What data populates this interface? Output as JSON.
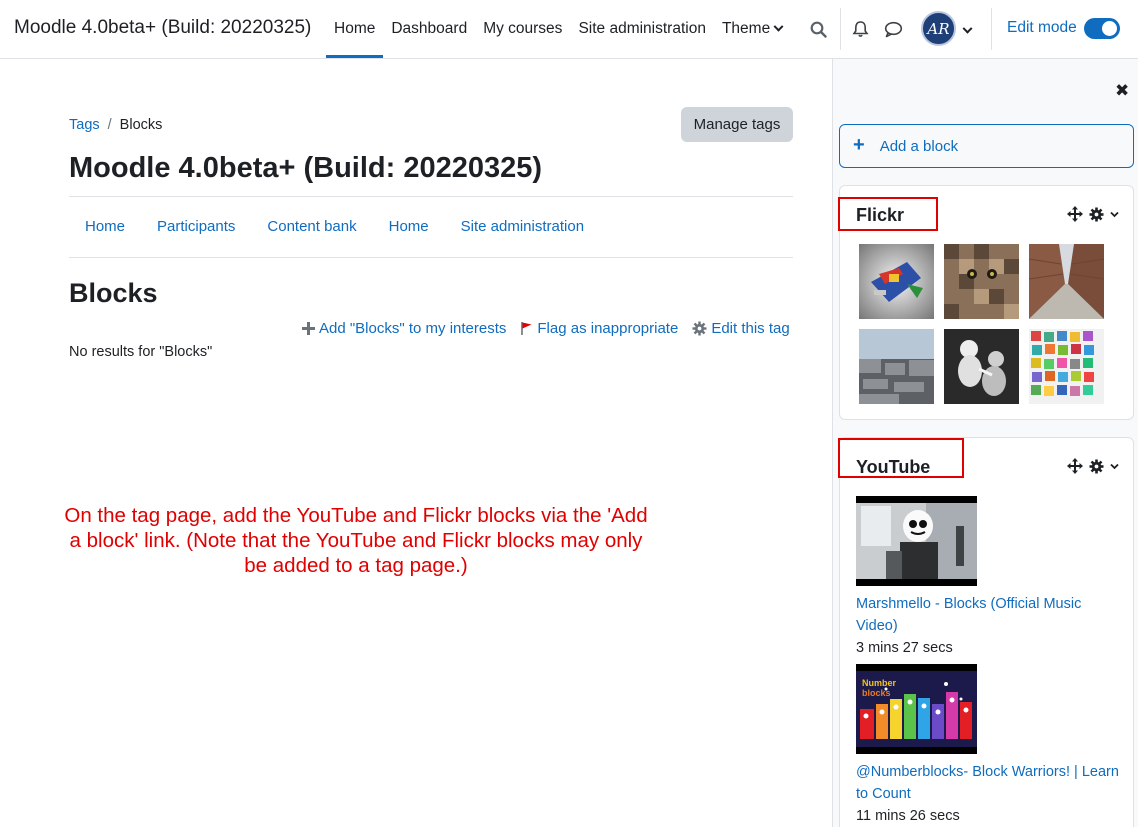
{
  "header": {
    "site_name": "Moodle 4.0beta+ (Build: 20220325)",
    "nav": [
      "Home",
      "Dashboard",
      "My courses",
      "Site administration",
      "Theme"
    ],
    "active_nav": "Home",
    "avatar_initials": "AR",
    "edit_mode_label": "Edit mode",
    "edit_mode_on": true
  },
  "breadcrumb": {
    "link": "Tags",
    "separator": "/",
    "current": "Blocks"
  },
  "manage_tags_label": "Manage tags",
  "page_title": "Moodle 4.0beta+ (Build: 20220325)",
  "secondary_nav": [
    "Home",
    "Participants",
    "Content bank",
    "Home",
    "Site administration"
  ],
  "tag": {
    "heading": "Blocks",
    "add_interest": "Add \"Blocks\" to my interests",
    "flag": "Flag as inappropriate",
    "edit": "Edit this tag",
    "no_results": "No results for \"Blocks\""
  },
  "annotation_text": "On the tag page, add the YouTube and Flickr blocks via the 'Add a block' link. (Note that the YouTube and Flickr blocks may only be added to a tag page.)",
  "drawer": {
    "close_icon": "close-icon",
    "add_block_label": "Add a block",
    "flickr": {
      "title": "Flickr",
      "photos": [
        "lego-spaceship",
        "pixel-cat",
        "brick-alley",
        "concrete-memorial",
        "white-figures",
        "toy-collage"
      ]
    },
    "youtube": {
      "title": "YouTube",
      "videos": [
        {
          "title": "Marshmello - Blocks (Official Music Video)",
          "duration": "3 mins 27 secs"
        },
        {
          "title": "@Numberblocks- Block Warriors! | Learn to Count",
          "duration": "11 mins 26 secs"
        }
      ]
    }
  },
  "colors": {
    "link": "#0f6cbf",
    "annotation": "#e00000",
    "drawer_bg": "#f8f9fa"
  }
}
